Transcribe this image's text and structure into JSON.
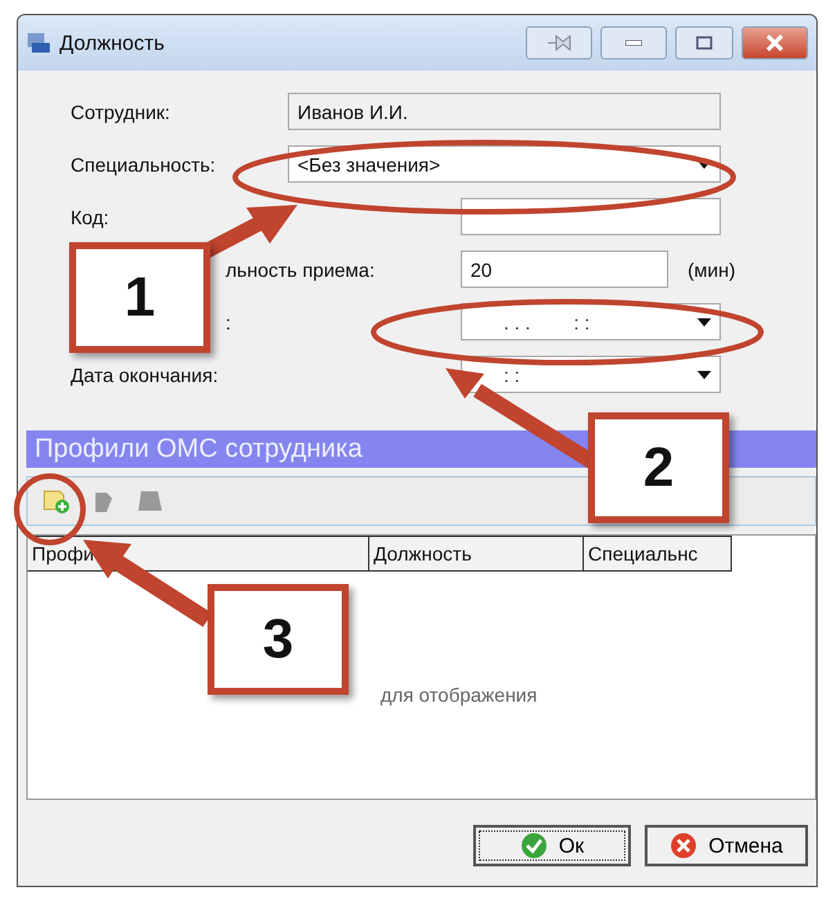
{
  "window": {
    "title": "Должность"
  },
  "fields": [
    {
      "kind": "text",
      "label": "Сотрудник:",
      "value": "Иванов И.И.",
      "readonly": true
    },
    {
      "kind": "combo",
      "label": "Специальность:",
      "value": "<Без значения>"
    },
    {
      "kind": "text",
      "label": "Код:"
    },
    {
      "kind": "text",
      "label": "льность приема:",
      "value": "20",
      "suffix": "(мин)"
    },
    {
      "kind": "date",
      "label": ":",
      "value": ". . .        : :"
    },
    {
      "kind": "date",
      "label": "Дата окончания:",
      "value": ": :"
    }
  ],
  "section": {
    "title": "Профили ОМС сотрудника"
  },
  "toolbar": [
    {
      "kind": "add",
      "disabled": false
    },
    {
      "kind": "edit",
      "disabled": true
    },
    {
      "kind": "delete",
      "disabled": true
    }
  ],
  "table": {
    "columns": [
      "Профи",
      "Должность",
      "Специальнс"
    ],
    "empty_text": "для отображения"
  },
  "buttons": [
    {
      "kind": "ok",
      "label": "Ок"
    },
    {
      "kind": "cancel",
      "label": "Отмена"
    }
  ],
  "callouts": [
    {
      "number": "1"
    },
    {
      "number": "2"
    },
    {
      "number": "3"
    }
  ]
}
